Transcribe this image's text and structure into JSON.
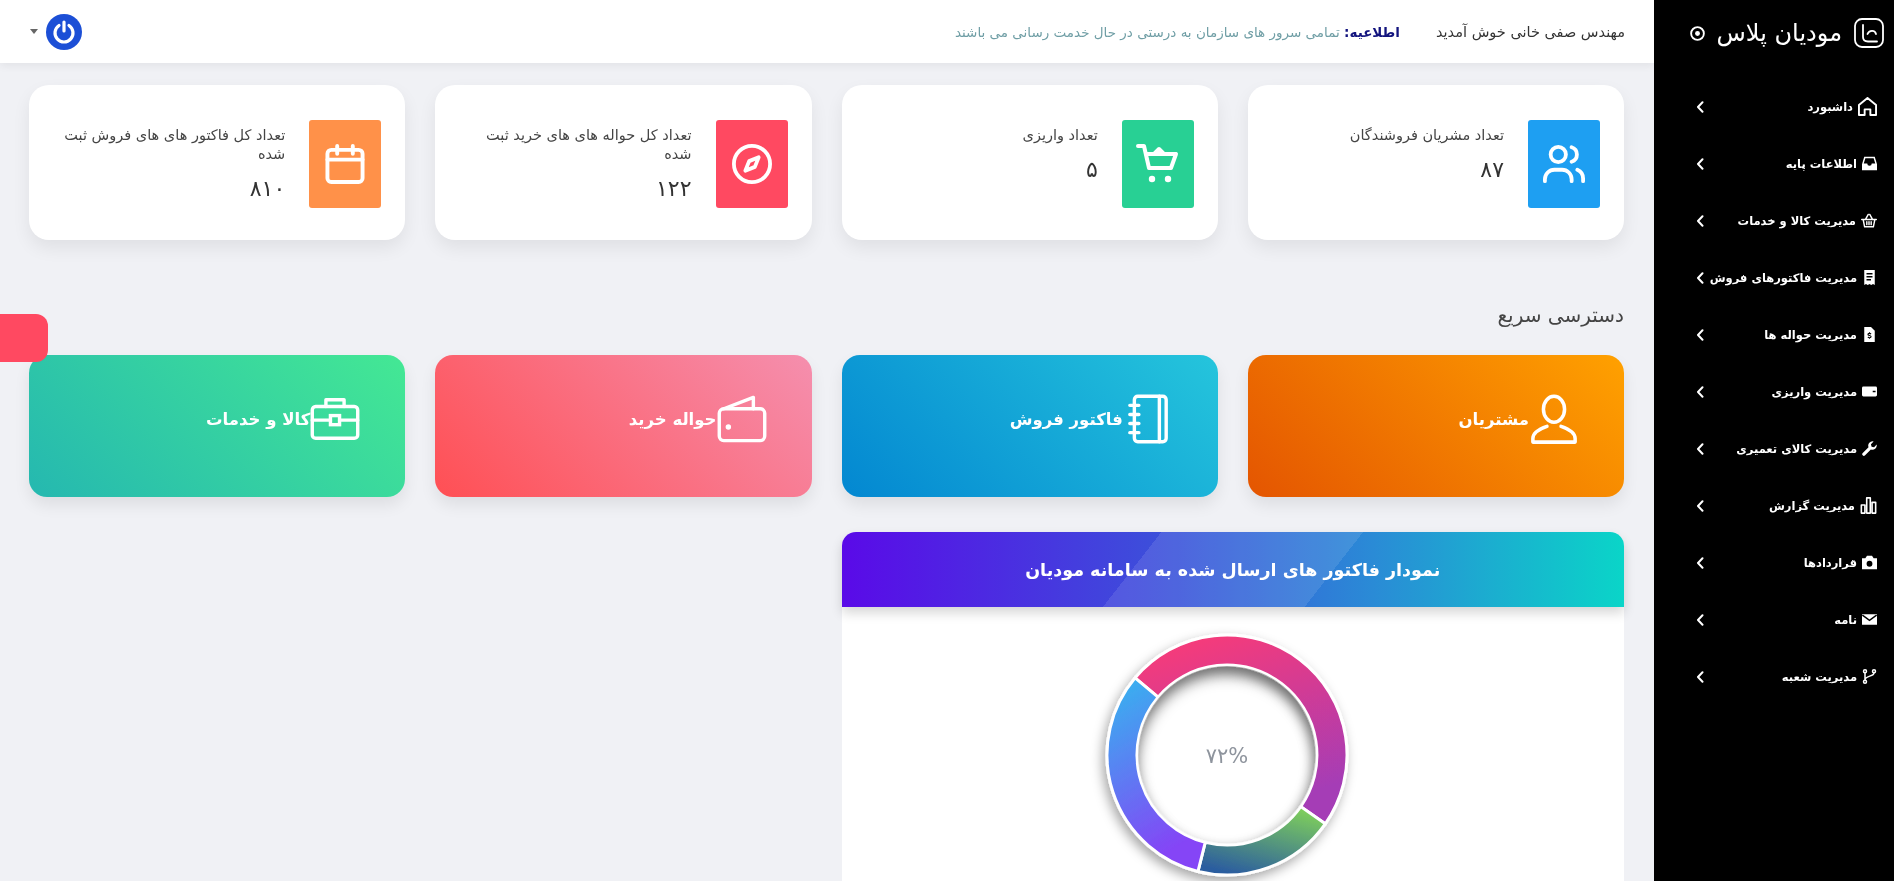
{
  "sidebar": {
    "brand": "مودیان پلاس",
    "items": [
      {
        "label": "داشبورد"
      },
      {
        "label": "اطلاعات پایه"
      },
      {
        "label": "مدیریت کالا و خدمات"
      },
      {
        "label": "مدیریت فاکتورهای فروش"
      },
      {
        "label": "مدیریت حواله ها"
      },
      {
        "label": "مدیریت واریزی"
      },
      {
        "label": "مدیریت کالای تعمیری"
      },
      {
        "label": "مدیریت گزارش"
      },
      {
        "label": "قراردادها"
      },
      {
        "label": "نامه"
      },
      {
        "label": "مدیریت شعبه"
      }
    ]
  },
  "topbar": {
    "welcome": "مهندس صفی خانی خوش آمدید",
    "notice": "**اطلاعیه:** تمامی سرور های سازمان به درستی در حال خدمت رسانی می باشند"
  },
  "stats": [
    {
      "label": "تعداد مشریان فروشندگان",
      "value": "۸۷",
      "color": "#1e9ff2"
    },
    {
      "label": "تعداد واریزی",
      "value": "۵",
      "color": "#28d094"
    },
    {
      "label": "تعداد کل حواله های های خرید ثبت شده",
      "value": "۱۲۲",
      "color": "#ff4961"
    },
    {
      "label": "تعداد کل فاکتور های های فروش ثبت شده",
      "value": "۸۱۰",
      "color": "#ff9149"
    }
  ],
  "quick_access": {
    "title": "دسترسی سریع",
    "items": [
      {
        "label": "مشتریان"
      },
      {
        "label": "فاکتور فروش"
      },
      {
        "label": "حواله خرید"
      },
      {
        "label": "کالا و خدمات"
      }
    ]
  },
  "chart_card": {
    "title": "نمودار فاکتور های ارسال شده به سامانه مودیان",
    "center_label": "۷۲%"
  }
}
